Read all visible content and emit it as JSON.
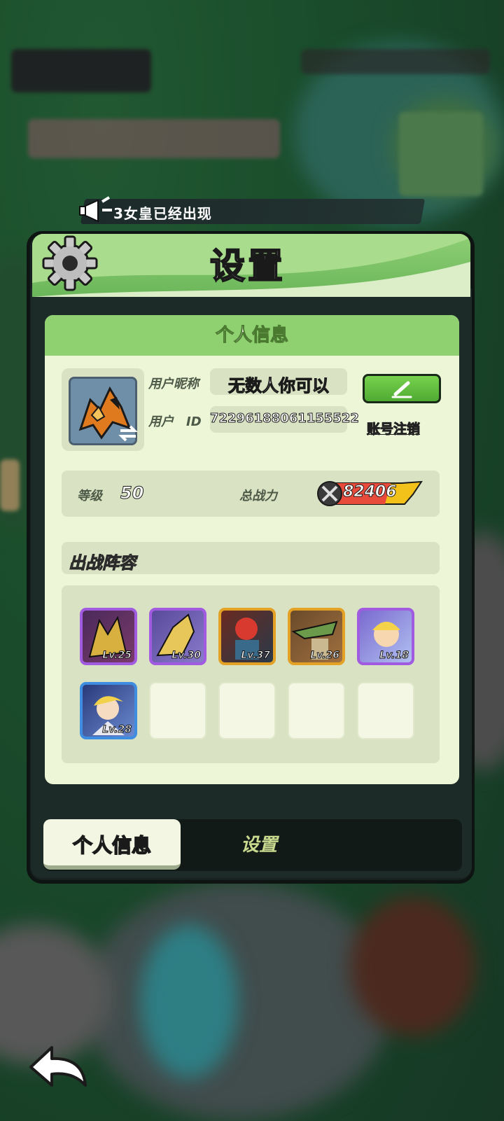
{
  "announcement": {
    "text": "3女皇已经出现"
  },
  "panel": {
    "title": "设置"
  },
  "profile": {
    "section_title": "个人信息",
    "nickname_label": "用户昵称",
    "nickname_value": "无数人你可以",
    "id_label": "用户　ID",
    "id_value": "72296188061155522",
    "cancel_account": "账号注销",
    "level_label": "等级",
    "level_value": "50",
    "power_label": "总战力",
    "power_value": "82406"
  },
  "lineup": {
    "title": "出战阵容",
    "heroes": [
      {
        "level": "Lv.25",
        "rarity": "purple"
      },
      {
        "level": "Lv.30",
        "rarity": "purple"
      },
      {
        "level": "Lv.37",
        "rarity": "orange"
      },
      {
        "level": "Lv.26",
        "rarity": "orange"
      },
      {
        "level": "Lv.18",
        "rarity": "purple"
      },
      {
        "level": "Lv.28",
        "rarity": "blue"
      }
    ]
  },
  "tabs": {
    "active": "个人信息",
    "inactive": "设置"
  },
  "icons": {
    "settings": "gear-icon",
    "announce": "megaphone-icon",
    "edit": "pencil-icon",
    "swap": "swap-icon",
    "power": "crossed-swords-icon",
    "back": "back-arrow-icon"
  },
  "colors": {
    "header_green": "#6bb65a",
    "card_bg": "#eef6d8",
    "rarity_purple": "#a15be0",
    "rarity_orange": "#e3a126",
    "rarity_blue": "#3f8de0"
  }
}
